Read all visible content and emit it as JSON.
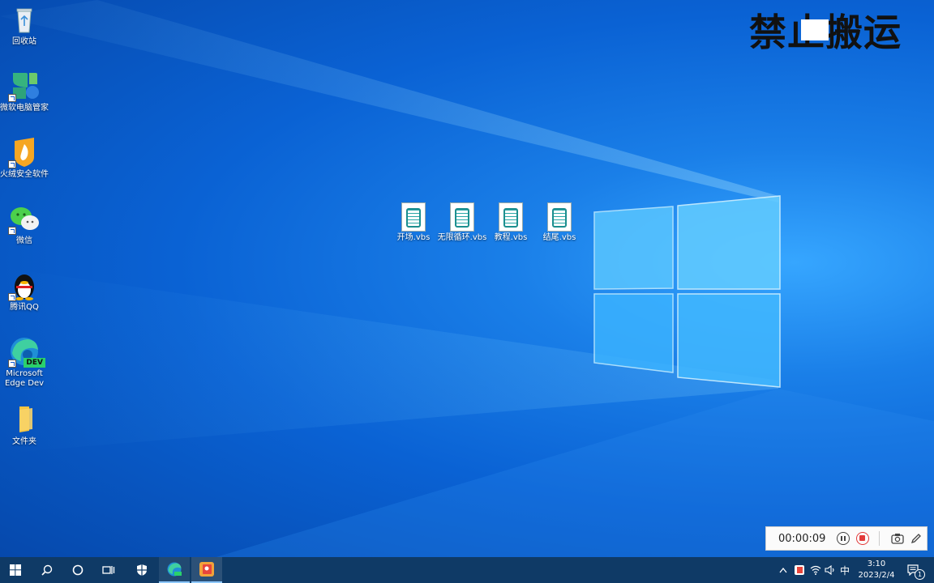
{
  "desktop": {
    "icons": [
      {
        "label": "回收站",
        "icon": "recycle-bin-icon"
      },
      {
        "label": "微软电脑管家",
        "icon": "pc-manager-icon"
      },
      {
        "label": "火绒安全软件",
        "icon": "huorong-icon"
      },
      {
        "label": "微信",
        "icon": "wechat-icon"
      },
      {
        "label": "腾讯QQ",
        "icon": "qq-penguin-icon"
      },
      {
        "label": "Microsoft Edge Dev",
        "icon": "edge-dev-icon"
      },
      {
        "label": "文件夹",
        "icon": "folder-icon"
      }
    ],
    "edge_badge": "DEV",
    "files": [
      {
        "label": "开场.vbs",
        "icon": "vbs-script-icon"
      },
      {
        "label": "无限循环.vbs",
        "icon": "vbs-script-icon"
      },
      {
        "label": "教程.vbs",
        "icon": "vbs-script-icon"
      },
      {
        "label": "结尾.vbs",
        "icon": "vbs-script-icon"
      }
    ]
  },
  "watermark": {
    "text": "禁止搬运"
  },
  "recorder": {
    "elapsed": "00:00:09"
  },
  "taskbar": {
    "pinned": [
      "start-icon",
      "search-icon",
      "cortana-icon",
      "task-view-icon",
      "security-shield-icon",
      "edge-dev-icon",
      "app-icon"
    ],
    "tray": {
      "ime": "中",
      "time": "3:10",
      "date": "2023/2/4",
      "notification_count": "1"
    }
  },
  "colors": {
    "accent": "#0a62d4",
    "taskbar": "#0f3a66",
    "stop": "#e23a3a"
  }
}
